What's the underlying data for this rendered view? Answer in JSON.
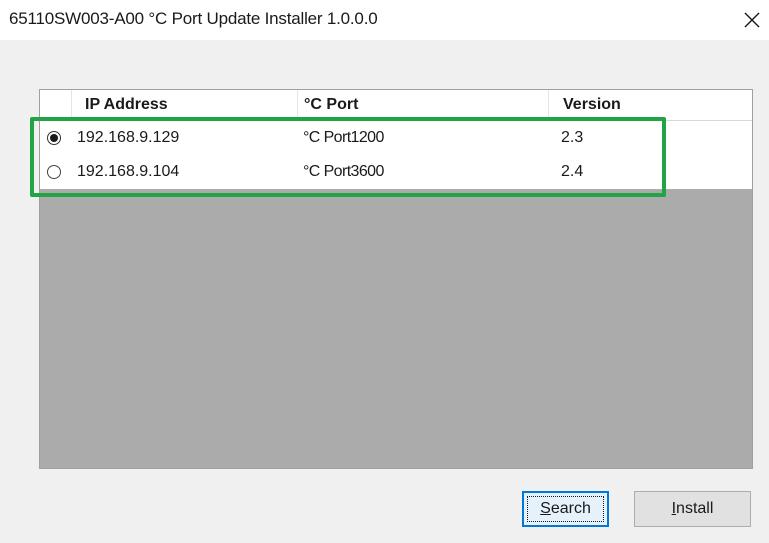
{
  "window": {
    "title": "65110SW003-A00 °C Port Update Installer 1.0.0.0"
  },
  "list": {
    "columns": [
      "IP Address",
      "°C Port",
      "Version"
    ],
    "rows": [
      {
        "selected": true,
        "ip": "192.168.9.129",
        "port": "°C Port1200",
        "version": "2.3"
      },
      {
        "selected": false,
        "ip": "192.168.9.104",
        "port": "°C Port3600",
        "version": "2.4"
      }
    ]
  },
  "buttons": {
    "search": {
      "mnemonic": "S",
      "rest": "earch"
    },
    "install": {
      "mnemonic": "I",
      "rest": "nstall"
    }
  },
  "colors": {
    "highlight": "#22a345",
    "focus_border": "#0078d7",
    "empty_list_area": "#ababab"
  },
  "icons": {
    "close": "close-icon"
  }
}
